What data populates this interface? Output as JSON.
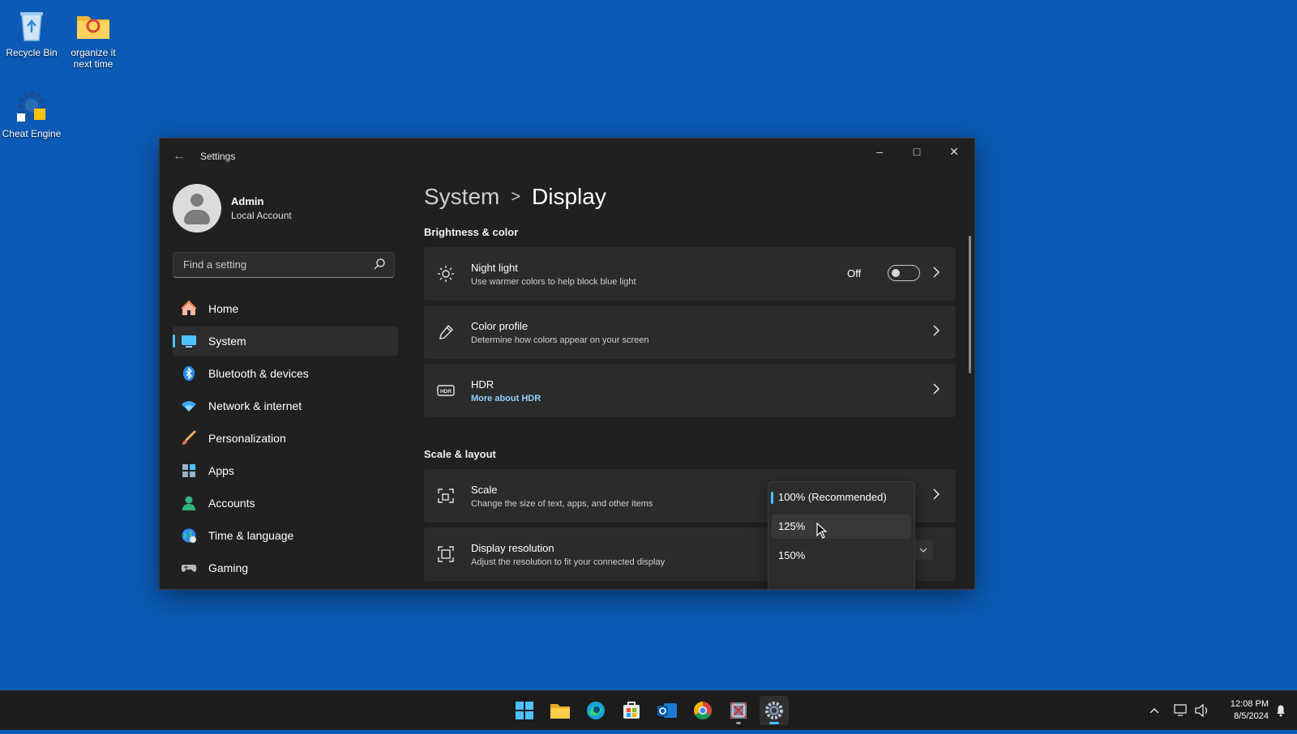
{
  "desktop": {
    "icons": [
      {
        "label": "Recycle Bin",
        "icon": "recycle-bin-icon"
      },
      {
        "label": "organize it next time",
        "icon": "folder-icon"
      },
      {
        "label": "Cheat Engine",
        "icon": "cheat-engine-icon"
      }
    ]
  },
  "window": {
    "title": "Settings",
    "controls": [
      "minimize",
      "maximize",
      "close"
    ]
  },
  "profile": {
    "name": "Admin",
    "account_type": "Local Account"
  },
  "search": {
    "placeholder": "Find a setting"
  },
  "sidebar": {
    "items": [
      {
        "label": "Home",
        "icon": "home-icon",
        "active": false
      },
      {
        "label": "System",
        "icon": "system-icon",
        "active": true
      },
      {
        "label": "Bluetooth & devices",
        "icon": "bluetooth-icon",
        "active": false
      },
      {
        "label": "Network & internet",
        "icon": "wifi-icon",
        "active": false
      },
      {
        "label": "Personalization",
        "icon": "brush-icon",
        "active": false
      },
      {
        "label": "Apps",
        "icon": "apps-icon",
        "active": false
      },
      {
        "label": "Accounts",
        "icon": "accounts-icon",
        "active": false
      },
      {
        "label": "Time & language",
        "icon": "globe-icon",
        "active": false
      },
      {
        "label": "Gaming",
        "icon": "gamepad-icon",
        "active": false
      }
    ]
  },
  "breadcrumb": {
    "parent": "System",
    "separator": ">",
    "current": "Display"
  },
  "sections": {
    "brightness": "Brightness & color",
    "scale_layout": "Scale & layout"
  },
  "cards": {
    "night_light": {
      "title": "Night light",
      "subtitle": "Use warmer colors to help block blue light",
      "state_label": "Off",
      "enabled": false
    },
    "color_profile": {
      "title": "Color profile",
      "subtitle": "Determine how colors appear on your screen"
    },
    "hdr": {
      "title": "HDR",
      "subtitle": "More about HDR"
    },
    "scale": {
      "title": "Scale",
      "subtitle": "Change the size of text, apps, and other items"
    },
    "display_resolution": {
      "title": "Display resolution",
      "subtitle": "Adjust the resolution to fit your connected display"
    }
  },
  "scale_dropdown": {
    "options": [
      "100% (Recommended)",
      "125%",
      "150%"
    ],
    "selected": "100% (Recommended)",
    "hovered": "125%"
  },
  "taskbar": {
    "apps": [
      "start-icon",
      "file-explorer-icon",
      "edge-icon",
      "store-icon",
      "outlook-icon",
      "chrome-icon",
      "game-app-icon",
      "settings-icon"
    ],
    "active_app": "settings-icon"
  },
  "tray": {
    "time": "12:08 PM",
    "date": "8/5/2024"
  },
  "colors": {
    "desktop": "#0b5ab5",
    "window_bg": "#202020",
    "card_bg": "#2b2b2b",
    "accent": "#4cc2ff",
    "link": "#8fd3ff"
  }
}
